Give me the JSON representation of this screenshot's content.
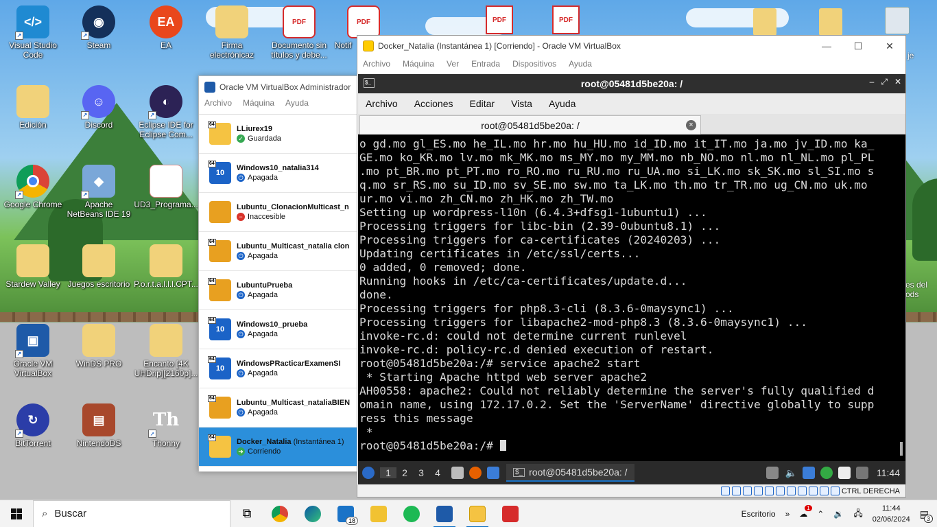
{
  "desktop": {
    "icons": [
      {
        "label": "Visual Studio Code"
      },
      {
        "label": "Steam"
      },
      {
        "label": "EA"
      },
      {
        "label": "Firma electrónicaz"
      },
      {
        "label": "Documento sin títulos y debe..."
      },
      {
        "label": "Notif"
      },
      {
        "label": "Edición"
      },
      {
        "label": "Discord"
      },
      {
        "label": "Eclipse IDE for Eclipse Com..."
      },
      {
        "label": "Google Chrome"
      },
      {
        "label": "Apache NetBeans IDE 19"
      },
      {
        "label": "UD3_Programa..."
      },
      {
        "label": "Stardew Valley"
      },
      {
        "label": "Juegos escritorio"
      },
      {
        "label": "P.o.r.t.a.l.l.l.CPT..."
      },
      {
        "label": "Oracle VM VirtualBox"
      },
      {
        "label": "WinDS PRO"
      },
      {
        "label": "Encanto [4K UHDrip][2160p]..."
      },
      {
        "label": "BitTorrent"
      },
      {
        "label": "NintendoDS"
      },
      {
        "label": "Thonny"
      },
      {
        "label": "PDF"
      },
      {
        "label": "je"
      },
      {
        "label": "es del"
      },
      {
        "label": "ods"
      }
    ]
  },
  "vbmanager": {
    "title": "Oracle VM VirtualBox Administrador",
    "menu": [
      "Archivo",
      "Máquina",
      "Ayuda"
    ],
    "vms": [
      {
        "name": "LLiurex19",
        "snapshot": "",
        "status": "Guardada",
        "os_badge": "64",
        "os_label": "",
        "color": "#f5c342",
        "status_color": "#36a852",
        "status_icon": "✓"
      },
      {
        "name": "Windows10_natalia314",
        "snapshot": "",
        "status": "Apagada",
        "os_badge": "64",
        "os_label": "10",
        "color": "#1b63c7",
        "status_color": "#1b63c7",
        "status_icon": "⏻"
      },
      {
        "name": "Lubuntu_ClonacionMulticast_n",
        "snapshot": "",
        "status": "Inaccesible",
        "os_badge": "",
        "os_label": "",
        "color": "#e8a020",
        "status_color": "#d9342b",
        "status_icon": "−"
      },
      {
        "name": "Lubuntu_Multicast_natalia clon",
        "snapshot": "",
        "status": "Apagada",
        "os_badge": "64",
        "os_label": "",
        "color": "#e8a020",
        "status_color": "#1b63c7",
        "status_icon": "⏻"
      },
      {
        "name": "LubuntuPrueba",
        "snapshot": "",
        "status": "Apagada",
        "os_badge": "64",
        "os_label": "",
        "color": "#e8a020",
        "status_color": "#1b63c7",
        "status_icon": "⏻"
      },
      {
        "name": "Windows10_prueba",
        "snapshot": "",
        "status": "Apagada",
        "os_badge": "64",
        "os_label": "10",
        "color": "#1b63c7",
        "status_color": "#1b63c7",
        "status_icon": "⏻"
      },
      {
        "name": "WindowsPRacticarExamenSI",
        "snapshot": "",
        "status": "Apagada",
        "os_badge": "64",
        "os_label": "10",
        "color": "#1b63c7",
        "status_color": "#1b63c7",
        "status_icon": "⏻"
      },
      {
        "name": "Lubuntu_Multicast_nataliaBIEN",
        "snapshot": "",
        "status": "Apagada",
        "os_badge": "64",
        "os_label": "",
        "color": "#e8a020",
        "status_color": "#1b63c7",
        "status_icon": "⏻"
      },
      {
        "name": "Docker_Natalia",
        "snapshot": "(Instantánea 1)",
        "status": "Corriendo",
        "os_badge": "64",
        "os_label": "",
        "color": "#f5c342",
        "status_color": "#36a852",
        "status_icon": "➜",
        "selected": true
      }
    ]
  },
  "vmwindow": {
    "title": "Docker_Natalia (Instantánea 1) [Corriendo] - Oracle VM VirtualBox",
    "menu": [
      "Archivo",
      "Máquina",
      "Ver",
      "Entrada",
      "Dispositivos",
      "Ayuda"
    ],
    "hostkey": "CTRL DERECHA"
  },
  "terminal": {
    "window_title": "root@05481d5be20a: /",
    "menu": [
      "Archivo",
      "Acciones",
      "Editar",
      "Vista",
      "Ayuda"
    ],
    "tab_title": "root@05481d5be20a: /",
    "lines": [
      "o gd.mo gl_ES.mo he_IL.mo hr.mo hu_HU.mo id_ID.mo it_IT.mo ja.mo jv_ID.mo ka_",
      "GE.mo ko_KR.mo lv.mo mk_MK.mo ms_MY.mo my_MM.mo nb_NO.mo nl.mo nl_NL.mo pl_PL",
      ".mo pt_BR.mo pt_PT.mo ro_RO.mo ru_RU.mo ru_UA.mo si_LK.mo sk_SK.mo sl_SI.mo s",
      "q.mo sr_RS.mo su_ID.mo sv_SE.mo sw.mo ta_LK.mo th.mo tr_TR.mo ug_CN.mo uk.mo",
      "ur.mo vi.mo zh_CN.mo zh_HK.mo zh_TW.mo",
      "Setting up wordpress-l10n (6.4.3+dfsg1-1ubuntu1) ...",
      "Processing triggers for libc-bin (2.39-0ubuntu8.1) ...",
      "Processing triggers for ca-certificates (20240203) ...",
      "Updating certificates in /etc/ssl/certs...",
      "0 added, 0 removed; done.",
      "Running hooks in /etc/ca-certificates/update.d...",
      "done.",
      "Processing triggers for php8.3-cli (8.3.6-0maysync1) ...",
      "Processing triggers for libapache2-mod-php8.3 (8.3.6-0maysync1) ...",
      "invoke-rc.d: could not determine current runlevel",
      "invoke-rc.d: policy-rc.d denied execution of restart.",
      "root@05481d5be20a:/# service apache2 start",
      " * Starting Apache httpd web server apache2",
      "AH00558: apache2: Could not reliably determine the server's fully qualified d",
      "omain name, using 172.17.0.2. Set the 'ServerName' directive globally to supp",
      "ress this message",
      " *"
    ],
    "prompt": "root@05481d5be20a:/# "
  },
  "lxqt_panel": {
    "workspaces": [
      "1",
      "2",
      "3",
      "4"
    ],
    "task": "root@05481d5be20a: /",
    "clock": "11:44"
  },
  "taskbar": {
    "search_placeholder": "Buscar",
    "mail_badge": "18",
    "desktop_label": "Escritorio",
    "time": "11:44",
    "date": "02/06/2024",
    "notif_count": "3",
    "tray_badge": "1"
  }
}
